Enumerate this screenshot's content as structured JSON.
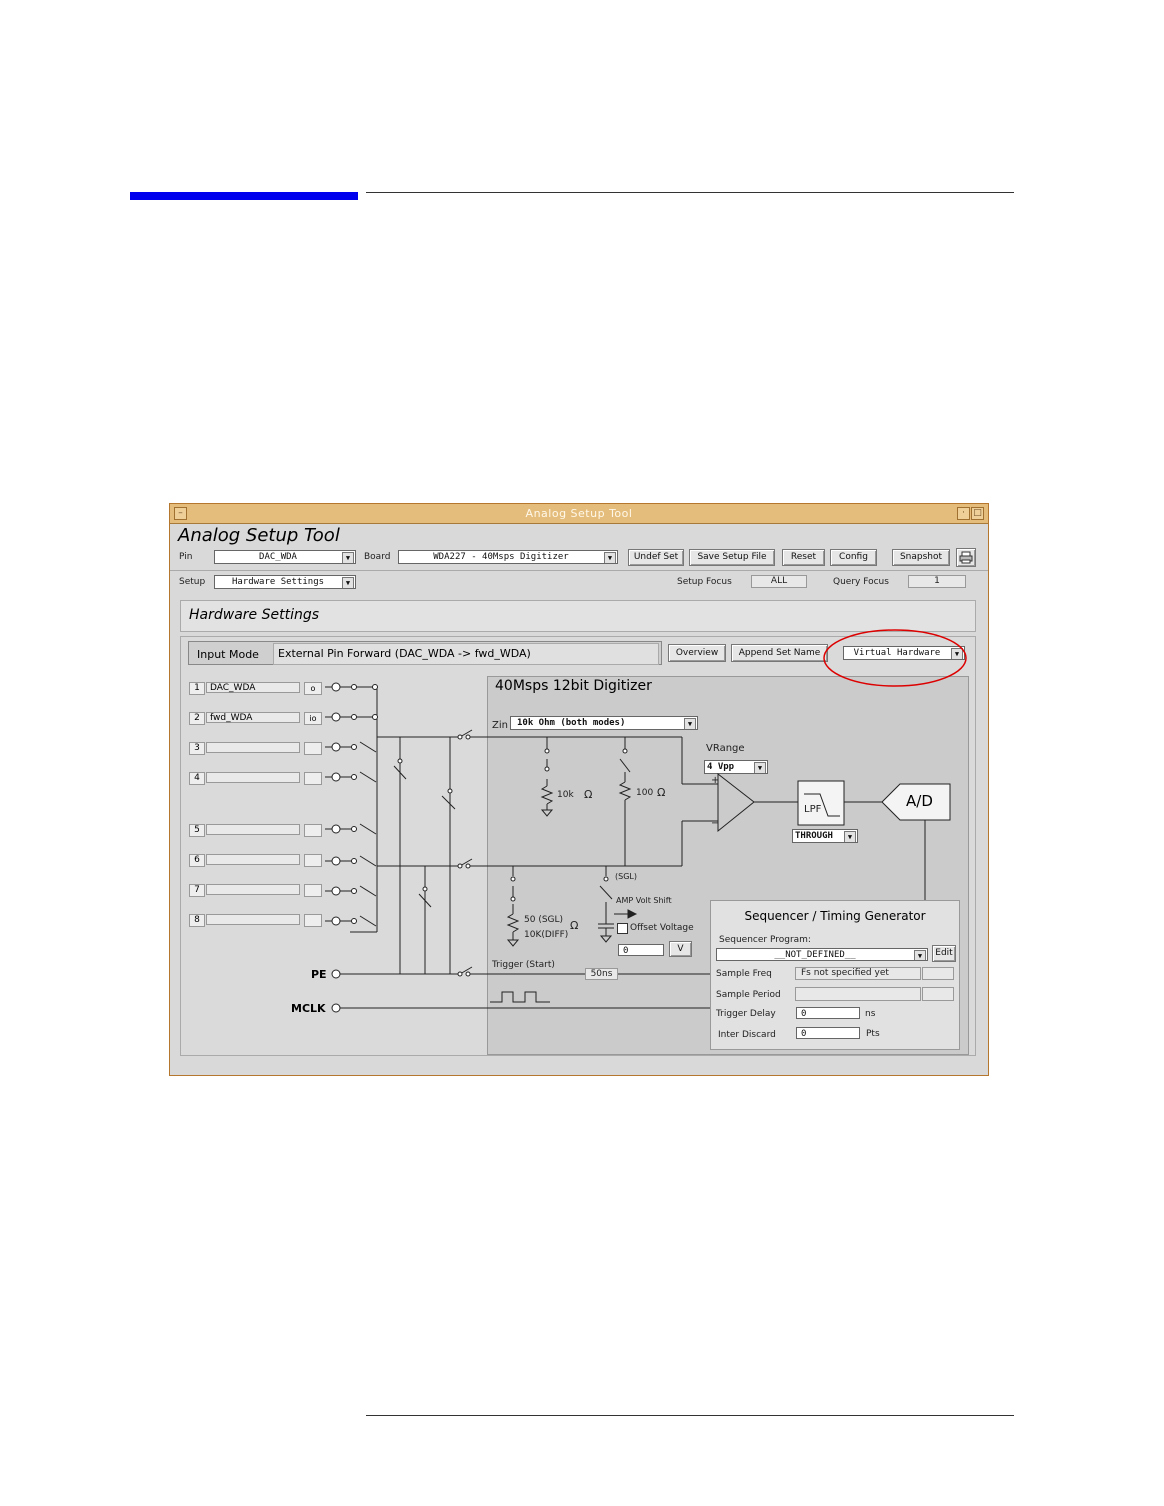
{
  "window": {
    "title": "Analog Setup Tool",
    "app_title": "Analog Setup Tool",
    "accent_color": "#e4bd7d"
  },
  "toolbar": {
    "pin_label": "Pin",
    "pin_value": "DAC_WDA",
    "board_label": "Board",
    "board_value": "WDA227   -  40Msps Digitizer",
    "buttons": [
      "Undef Set",
      "Save Setup File",
      "Reset",
      "Config",
      "Snapshot"
    ],
    "print_icon": "printer-icon"
  },
  "setup": {
    "label": "Setup",
    "value": "Hardware Settings",
    "focus_label": "Setup Focus",
    "focus_value": "ALL",
    "query_label": "Query Focus",
    "query_value": "1"
  },
  "section_title": "Hardware Settings",
  "input_mode": {
    "label": "Input Mode",
    "value": "External  Pin  Forward  (DAC_WDA -> fwd_WDA)"
  },
  "mode_buttons": {
    "overview": "Overview",
    "append": "Append Set Name",
    "hardware": "Virtual Hardware"
  },
  "pins": [
    {
      "num": "1",
      "name": "DAC_WDA",
      "io": "o"
    },
    {
      "num": "2",
      "name": "fwd_WDA",
      "io": "io"
    },
    {
      "num": "3",
      "name": "",
      "io": ""
    },
    {
      "num": "4",
      "name": "",
      "io": ""
    },
    {
      "num": "5",
      "name": "",
      "io": ""
    },
    {
      "num": "6",
      "name": "",
      "io": ""
    },
    {
      "num": "7",
      "name": "",
      "io": ""
    },
    {
      "num": "8",
      "name": "",
      "io": ""
    }
  ],
  "digitizer": {
    "title": "40Msps 12bit Digitizer",
    "zin_label": "Zin",
    "zin_value": "10k Ohm  (both modes)",
    "r10k": "10k",
    "r100": "100",
    "ohm": "Ω",
    "vrange_label": "VRange",
    "vrange_value": "4   Vpp",
    "lpf_label": "LPF",
    "filter_value": "THROUGH",
    "ad_label": "A/D",
    "sgl": "(SGL)",
    "r50a": "50 (SGL)",
    "r50b": "10K(DIFF)",
    "amp_shift": "AMP Volt Shift",
    "offset_label": "Offset Voltage",
    "offset_value": "0",
    "offset_unit": "V",
    "trigger_label": "Trigger (Start)",
    "trigger_delay_value": "50ns",
    "pe_label": "PE",
    "mclk_label": "MCLK"
  },
  "sequencer": {
    "title": "Sequencer / Timing Generator",
    "program_label": "Sequencer Program:",
    "program_value": "__NOT_DEFINED__",
    "edit_label": "Edit",
    "rows": [
      {
        "label": "Sample Freq",
        "value": "Fs not specified yet",
        "unit": ""
      },
      {
        "label": "Sample Period",
        "value": "",
        "unit": ""
      },
      {
        "label": "Trigger Delay",
        "value": "0",
        "unit": "ns"
      },
      {
        "label": "Inter Discard",
        "value": "0",
        "unit": "Pts"
      }
    ]
  },
  "highlight_color": "#dd0000"
}
